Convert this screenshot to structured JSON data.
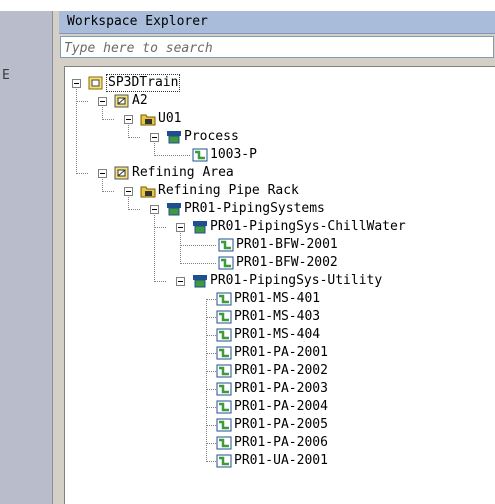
{
  "left_pane": {
    "letter": "E"
  },
  "panel": {
    "title": "Workspace Explorer",
    "search": {
      "placeholder": "Type here to search",
      "value": ""
    }
  },
  "tree": {
    "root": "SP3DTrain",
    "a2": "A2",
    "u01": "U01",
    "process": "Process",
    "p1003": "1003-P",
    "refining_area": "Refining Area",
    "refining_pipe_rack": "Refining Pipe Rack",
    "piping_systems": "PR01-PipingSystems",
    "chillwater": "PR01-PipingSys-ChillWater",
    "bfw_2001": "PR01-BFW-2001",
    "bfw_2002": "PR01-BFW-2002",
    "utility": "PR01-PipingSys-Utility",
    "ms_401": "PR01-MS-401",
    "ms_403": "PR01-MS-403",
    "ms_404": "PR01-MS-404",
    "pa_2001": "PR01-PA-2001",
    "pa_2002": "PR01-PA-2002",
    "pa_2003": "PR01-PA-2003",
    "pa_2004": "PR01-PA-2004",
    "pa_2005": "PR01-PA-2005",
    "pa_2006": "PR01-PA-2006",
    "ua_2001": "PR01-UA-2001"
  },
  "colors": {
    "title_bar": "#a9bcd9",
    "panel_bg": "#d4d0c8",
    "left_pane": "#b9bccb",
    "pipeline_icon": "#3f9a3f",
    "system_icon": "#1f4f8f",
    "folder_icon": "#e8c840"
  }
}
